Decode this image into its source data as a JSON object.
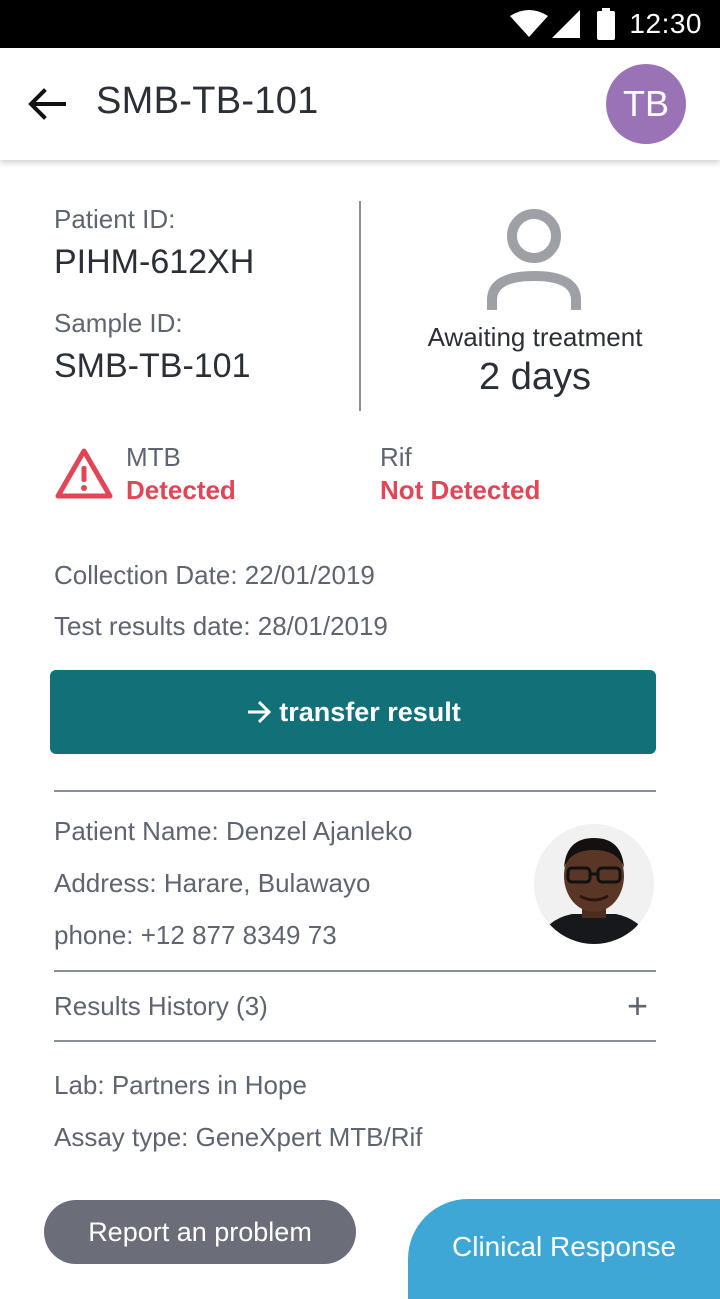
{
  "status_bar": {
    "time": "12:30"
  },
  "app_bar": {
    "title": "SMB-TB-101",
    "avatar_initials": "TB",
    "avatar_color": "#9a72b6"
  },
  "patient": {
    "patient_id_label": "Patient ID:",
    "patient_id": "PIHM-612XH",
    "sample_id_label": "Sample ID:",
    "sample_id": "SMB-TB-101",
    "awaiting_label": "Awaiting treatment",
    "awaiting_days": "2 days"
  },
  "results": {
    "mtb": {
      "name": "MTB",
      "status": "Detected"
    },
    "rif": {
      "name": "Rif",
      "status": "Not Detected"
    },
    "alert_color": "#e14556"
  },
  "dates": {
    "collection": "Collection Date: 22/01/2019",
    "test_results": "Test results date: 28/01/2019"
  },
  "transfer_button": {
    "label": "transfer result",
    "color": "#127178"
  },
  "details": {
    "name": "Patient Name: Denzel Ajanleko",
    "address": "Address: Harare, Bulawayo",
    "phone": "phone: +12 877 8349 73"
  },
  "history": {
    "label": "Results History (3)",
    "toggle": "+"
  },
  "lab": {
    "lab": "Lab: Partners in Hope",
    "assay": "Assay type: GeneXpert MTB/Rif"
  },
  "footer": {
    "report_button": "Report an problem",
    "clinical_response": "Clinical Response",
    "clinical_color": "#3ea7d6"
  }
}
